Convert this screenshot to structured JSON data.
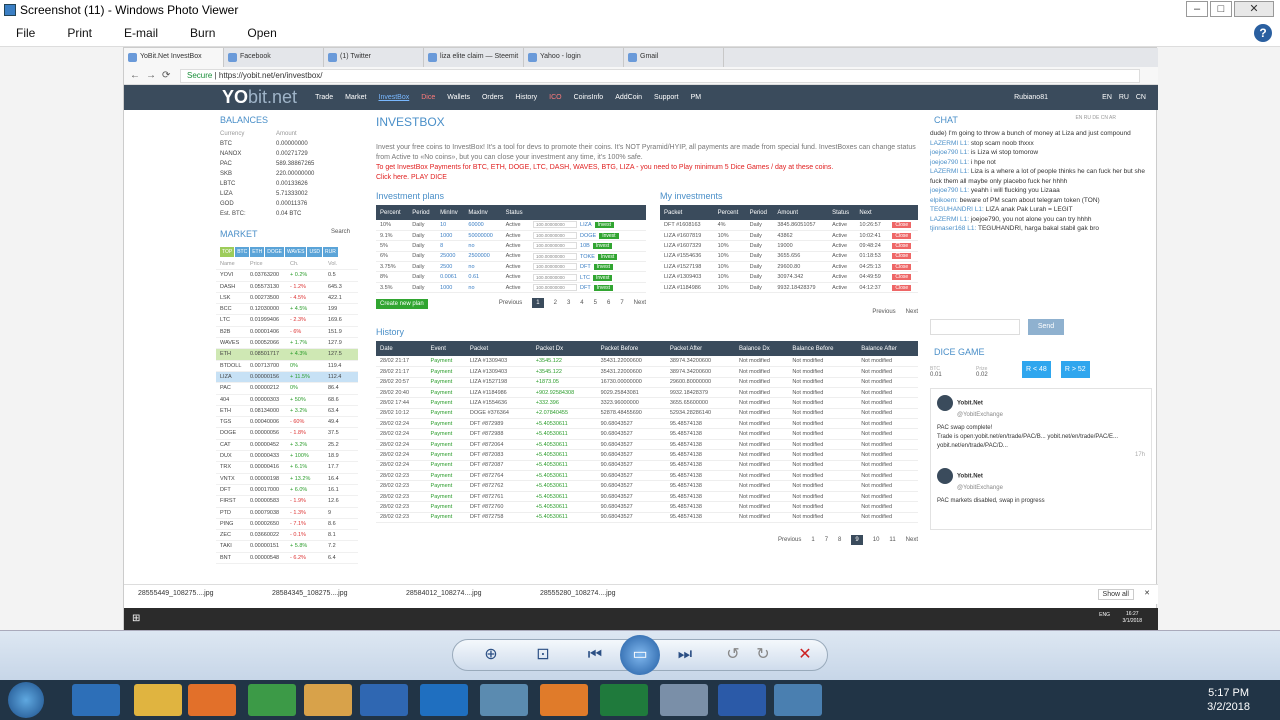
{
  "window": {
    "title": "Screenshot (11) - Windows Photo Viewer"
  },
  "menu": [
    "File",
    "Print",
    "E-mail",
    "Burn",
    "Open"
  ],
  "browser": {
    "tabs": [
      "YoBit.Net InvestBox",
      "Facebook",
      "(1) Twitter",
      "liza elite claim — Steemit",
      "Yahoo - login",
      "Gmail"
    ],
    "secure": "Secure",
    "url": "https://yobit.net/en/investbox/"
  },
  "site": {
    "logo_a": "YO",
    "logo_b": "bit.net",
    "nav": [
      "Trade",
      "Market",
      "InvestBox",
      "Dice",
      "Wallets",
      "Orders",
      "History",
      "ICO",
      "CoinsInfo",
      "AddCoin",
      "Support",
      "PM"
    ],
    "user": "Rubiano81",
    "langs": "EN RU CN"
  },
  "balances": {
    "title": "BALANCES",
    "hdr": [
      "Currency",
      "Amount"
    ],
    "rows": [
      [
        "BTC",
        "0.00000000"
      ],
      [
        "NANOX",
        "0.00271729"
      ],
      [
        "PAC",
        "589.38867265"
      ],
      [
        "SKB",
        "220.00000000"
      ],
      [
        "LBTC",
        "0.00133626"
      ],
      [
        "LIZA",
        "5.71333002"
      ],
      [
        "GOD",
        "0.00011376"
      ],
      [
        "Est. BTC:",
        "0.04 BTC"
      ]
    ]
  },
  "market": {
    "title": "MARKET",
    "search": "Search",
    "tabs": [
      "TOP",
      "BTC",
      "ETH",
      "DOGE",
      "WAVES",
      "USD",
      "RUR"
    ],
    "hdr": [
      "Name",
      "Price",
      "Ch.",
      "Vol."
    ],
    "rows": [
      [
        "YOVI",
        "0.03763200",
        "+ 0.2%",
        "0.5"
      ],
      [
        "DASH",
        "0.05573130",
        "- 1.2%",
        "645.3"
      ],
      [
        "LSK",
        "0.00273500",
        "- 4.5%",
        "422.1"
      ],
      [
        "BCC",
        "0.12030000",
        "+ 4.5%",
        "199"
      ],
      [
        "LTC",
        "0.01999406",
        "- 2.3%",
        "169.6"
      ],
      [
        "B2B",
        "0.00001406",
        "- 6%",
        "151.9"
      ],
      [
        "WAVES",
        "0.00052066",
        "+ 1.7%",
        "127.9"
      ],
      [
        "ETH",
        "0.08501717",
        "+ 4.3%",
        "127.5"
      ],
      [
        "BTDOLL",
        "0.00713700",
        "0%",
        "119.4"
      ],
      [
        "LIZA",
        "0.00000156",
        "+ 11.5%",
        "112.4"
      ],
      [
        "PAC",
        "0.00000212",
        "0%",
        "86.4"
      ],
      [
        "404",
        "0.00000303",
        "+ 50%",
        "68.6"
      ],
      [
        "ETH",
        "0.08134000",
        "+ 3.2%",
        "63.4"
      ],
      [
        "TGS",
        "0.00040006",
        "- 60%",
        "49.4"
      ],
      [
        "DOGE",
        "0.00000056",
        "- 1.8%",
        "37.5"
      ],
      [
        "CAT",
        "0.00000452",
        "+ 3.2%",
        "25.2"
      ],
      [
        "DUX",
        "0.00000433",
        "+ 100%",
        "18.9"
      ],
      [
        "TRX",
        "0.00000416",
        "+ 6.1%",
        "17.7"
      ],
      [
        "VNTX",
        "0.00000198",
        "+ 13.2%",
        "16.4"
      ],
      [
        "DFT",
        "0.00017000",
        "+ 6.0%",
        "16.1"
      ],
      [
        "FIRST",
        "0.00000583",
        "- 1.9%",
        "12.6"
      ],
      [
        "PTD",
        "0.00079038",
        "- 1.3%",
        "9"
      ],
      [
        "PING",
        "0.00002650",
        "- 7.1%",
        "8.6"
      ],
      [
        "ZEC",
        "0.03660022",
        "- 0.1%",
        "8.1"
      ],
      [
        "TAKI",
        "0.00000151",
        "+ 5.8%",
        "7.2"
      ],
      [
        "BNT",
        "0.00000548",
        "- 6.2%",
        "6.4"
      ]
    ]
  },
  "investbox": {
    "title": "INVESTBOX",
    "intro": "Invest your free coins to InvestBox! It's a tool for devs to promote their coins. It's NOT Pyramid/HYIP, all payments are made from special fund. InvestBoxes can change status from Active to «No coins», but you can close your investment any time, it's 100% safe.",
    "promo": "To get InvestBox Payments for BTC, ETH, DOGE, LTC, DASH, WAVES, BTG, LIZA - you need to Play minimum 5 Dice Games / day at these coins.",
    "promo_link": "Click here. PLAY DICE",
    "plans_title": "Investment plans",
    "plans_hdr": [
      "Percent",
      "Period",
      "MinInv",
      "MaxInv",
      "Status"
    ],
    "plans": [
      [
        "10%",
        "Daily",
        "10",
        "60000",
        "Active",
        "100.00000000",
        "LIZA"
      ],
      [
        "9.1%",
        "Daily",
        "1000",
        "50000000",
        "Active",
        "100.00000000",
        "DOGE"
      ],
      [
        "5%",
        "Daily",
        "8",
        "no",
        "Active",
        "100.00000000",
        "10B"
      ],
      [
        "6%",
        "Daily",
        "25000",
        "2500000",
        "Active",
        "100.00000000",
        "TOKE"
      ],
      [
        "3.75%",
        "Daily",
        "2500",
        "no",
        "Active",
        "100.00000000",
        "DFT"
      ],
      [
        "8%",
        "Daily",
        "0.0061",
        "0.61",
        "Active",
        "100.00000000",
        "LTC"
      ],
      [
        "3.5%",
        "Daily",
        "1000",
        "no",
        "Active",
        "100.00000000",
        "DFT"
      ]
    ],
    "invest": "Invest",
    "create": "Create new plan",
    "pager": [
      "Previous",
      "1",
      "2",
      "3",
      "4",
      "5",
      "6",
      "7",
      "Next"
    ],
    "my_title": "My investments",
    "my_hdr": [
      "Packet",
      "Percent",
      "Period",
      "Amount",
      "Status",
      "Next"
    ],
    "my": [
      [
        "DFT #1608163",
        "4%",
        "Daily",
        "3845.86051057",
        "Active",
        "10:26:57"
      ],
      [
        "LIZA #1607819",
        "10%",
        "Daily",
        "43862",
        "Active",
        "10:02:41"
      ],
      [
        "LIZA #1607329",
        "10%",
        "Daily",
        "19000",
        "Active",
        "09:48:24"
      ],
      [
        "LIZA #1554636",
        "10%",
        "Daily",
        "3655.656",
        "Active",
        "01:18:53"
      ],
      [
        "LIZA #1527198",
        "10%",
        "Daily",
        "29600.80",
        "Active",
        "04:25:13"
      ],
      [
        "LIZA #1309403",
        "10%",
        "Daily",
        "30974.342",
        "Active",
        "04:49:59"
      ],
      [
        "LIZA #1184986",
        "10%",
        "Daily",
        "9932.18428379",
        "Active",
        "04:12:37"
      ]
    ],
    "close": "Close",
    "my_pager": [
      "Previous",
      "Next"
    ],
    "hist_title": "History",
    "hist_hdr": [
      "Date",
      "Event",
      "Packet",
      "Packet Dx",
      "Packet Before",
      "Packet After",
      "Balance Dx",
      "Balance Before",
      "Balance After"
    ],
    "hist": [
      [
        "28/02 21:17",
        "Payment",
        "LIZA #1309403",
        "+3545.122",
        "35431.22000600",
        "38974.34200600",
        "Not modified",
        "Not modified",
        "Not modified"
      ],
      [
        "28/02 21:17",
        "Payment",
        "LIZA #1309403",
        "+3545.122",
        "35431.22000600",
        "38974.34200600",
        "Not modified",
        "Not modified",
        "Not modified"
      ],
      [
        "28/02 20:57",
        "Payment",
        "LIZA #1527198",
        "+1873.05",
        "16730.00000000",
        "29600.80000000",
        "Not modified",
        "Not modified",
        "Not modified"
      ],
      [
        "28/02 20:40",
        "Payment",
        "LIZA #1184986",
        "+902.92584308",
        "9029.25843081",
        "9932.18428379",
        "Not modified",
        "Not modified",
        "Not modified"
      ],
      [
        "28/02 17:44",
        "Payment",
        "LIZA #1554636",
        "+332.396",
        "3323.96000000",
        "3655.65600000",
        "Not modified",
        "Not modified",
        "Not modified"
      ],
      [
        "28/02 10:12",
        "Payment",
        "DOGE #376364",
        "+2.07840455",
        "52878.48455690",
        "52934.28286140",
        "Not modified",
        "Not modified",
        "Not modified"
      ],
      [
        "28/02 02:24",
        "Payment",
        "DFT #872989",
        "+5.40530611",
        "90.68043527",
        "95.48574138",
        "Not modified",
        "Not modified",
        "Not modified"
      ],
      [
        "28/02 02:24",
        "Payment",
        "DFT #872988",
        "+5.40530611",
        "90.68043527",
        "95.48574138",
        "Not modified",
        "Not modified",
        "Not modified"
      ],
      [
        "28/02 02:24",
        "Payment",
        "DFT #872064",
        "+5.40530611",
        "90.68043527",
        "95.48574138",
        "Not modified",
        "Not modified",
        "Not modified"
      ],
      [
        "28/02 02:24",
        "Payment",
        "DFT #872083",
        "+5.40530611",
        "90.68043527",
        "95.48574138",
        "Not modified",
        "Not modified",
        "Not modified"
      ],
      [
        "28/02 02:24",
        "Payment",
        "DFT #872087",
        "+5.40530611",
        "90.68043527",
        "95.48574138",
        "Not modified",
        "Not modified",
        "Not modified"
      ],
      [
        "28/02 02:23",
        "Payment",
        "DFT #872764",
        "+5.40530611",
        "90.68043527",
        "95.48574138",
        "Not modified",
        "Not modified",
        "Not modified"
      ],
      [
        "28/02 02:23",
        "Payment",
        "DFT #872762",
        "+5.40530611",
        "90.68043527",
        "95.48574138",
        "Not modified",
        "Not modified",
        "Not modified"
      ],
      [
        "28/02 02:23",
        "Payment",
        "DFT #872761",
        "+5.40530611",
        "90.68043527",
        "95.48574138",
        "Not modified",
        "Not modified",
        "Not modified"
      ],
      [
        "28/02 02:23",
        "Payment",
        "DFT #872760",
        "+5.40530611",
        "90.68043527",
        "95.48574138",
        "Not modified",
        "Not modified",
        "Not modified"
      ],
      [
        "28/02 02:23",
        "Payment",
        "DFT #872758",
        "+5.40530611",
        "90.68043527",
        "95.48574138",
        "Not modified",
        "Not modified",
        "Not modified"
      ]
    ],
    "hist_pager": [
      "Previous",
      "1",
      "7",
      "8",
      "9",
      "10",
      "11",
      "Next"
    ]
  },
  "chat": {
    "title": "CHAT",
    "langs": "EN RU DE CN AR",
    "msgs": [
      [
        "",
        "dude) I'm going to throw a bunch of money at Liza and just compound"
      ],
      [
        "LAZERMI L1:",
        "stop scam noob thxxx"
      ],
      [
        "joejoe790 L1:",
        "is Liza wi stop tomorow"
      ],
      [
        "joejoe790 L1:",
        "i hpe not"
      ],
      [
        "LAZERMI L1:",
        "Liza is a where a lot of people thinks he can fuck her but she fuck them all maybe only placebo fuck her hhhh"
      ],
      [
        "joejoe790 L1:",
        "yeahh i will flucking you Lizaaa"
      ],
      [
        "elpikoem:",
        "beware of PM scam about telegram token (TON)"
      ],
      [
        "TEGUHANDRI L1:",
        "LIZA anak Pak Lurah = LEGIT"
      ],
      [
        "LAZERMI L1:",
        "joejoe790, you not alone you can try hhhh"
      ],
      [
        "tjinnaser168 L1:",
        "TEGUHANDRI, harga bakal stabil gak bro"
      ]
    ],
    "send": "Send"
  },
  "dice": {
    "title": "DICE GAME",
    "bet_label": "BTC",
    "bet": "0.01",
    "profit_label": "Prize",
    "profit": "0.02",
    "lo": "R < 48",
    "hi": "R > 52"
  },
  "tweets": [
    {
      "name": "Yobit.Net",
      "handle": "@YobitExchange",
      "text": "PAC swap complete!\nTrade is open:yobit.net/en/trade/PAC/B... yobit.net/en/trade/PAC/E... yobit.net/en/trade/PAC/D...",
      "time": "17h"
    },
    {
      "name": "Yobit.Net",
      "handle": "@YobitExchange",
      "text": "PAC markets disabled, swap in progress"
    }
  ],
  "downloads": [
    "28555449_108275....jpg",
    "28584345_108275....jpg",
    "28584012_108274....jpg",
    "28555280_108274....jpg"
  ],
  "showall": "Show all",
  "inner_clock": {
    "time": "16:27",
    "date": "3/1/2018",
    "lang": "ENG"
  },
  "clock": {
    "time": "5:17 PM",
    "date": "3/2/2018"
  }
}
